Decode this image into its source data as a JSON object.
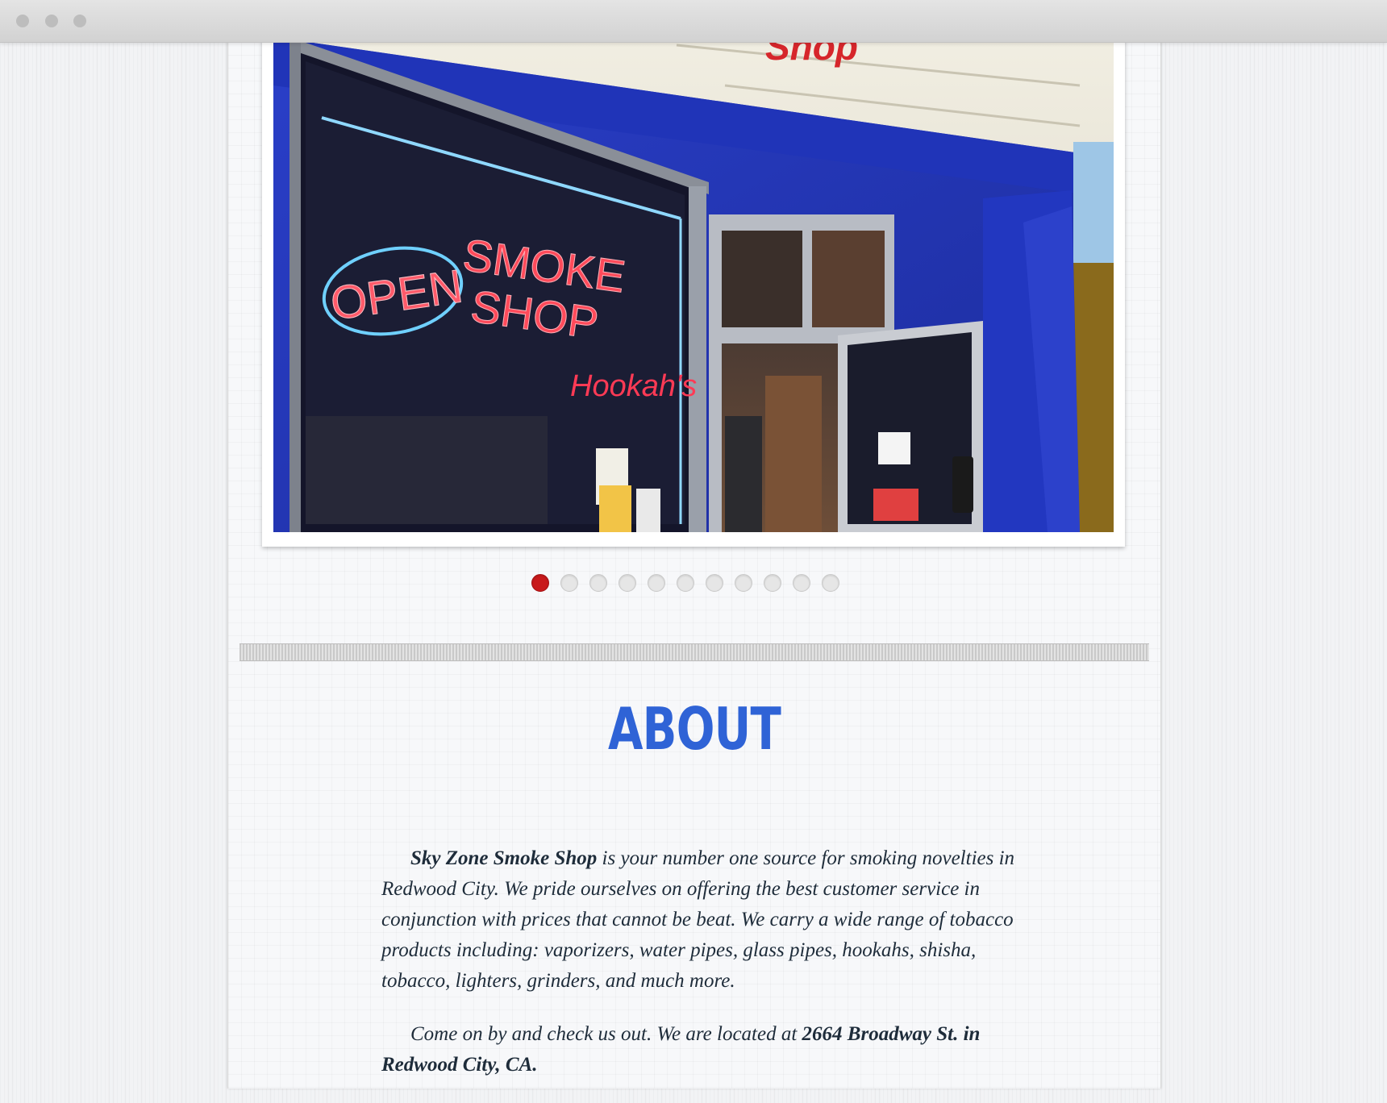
{
  "browser": {
    "window_controls": [
      "close",
      "minimize",
      "maximize"
    ]
  },
  "slider": {
    "photo_signs": {
      "store_sign_fragment": "Shop",
      "neon_open": "OPEN",
      "neon_smoke": "SMOKE",
      "neon_shop": "SHOP",
      "neon_hookahs": "Hookah's"
    },
    "dots_total": 11,
    "active_index": 0,
    "active_color": "#c8191b",
    "inactive_color": "#e6e6e6"
  },
  "about": {
    "title": "ABOUT",
    "title_color": "#2f63d6",
    "p1_bold": "Sky Zone Smoke Shop",
    "p1_text": " is your number one source for smoking novelties in Redwood City. We pride ourselves on offering the best customer service in conjunction with prices that cannot be beat. We carry a wide range of tobacco products including: vaporizers, water pipes, glass pipes, hookahs, shisha, tobacco, lighters, grinders, and much more.",
    "p2_text": "Come on by and check us out. We are located at ",
    "p2_bold": "2664 Broadway St. in Redwood City, CA."
  }
}
